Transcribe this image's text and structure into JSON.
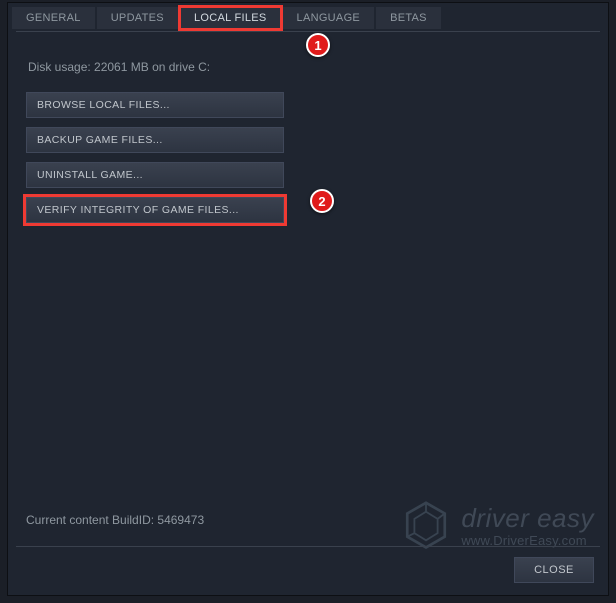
{
  "tabs": {
    "general": "GENERAL",
    "updates": "UPDATES",
    "local_files": "LOCAL FILES",
    "language": "LANGUAGE",
    "betas": "BETAS"
  },
  "disk_usage": "Disk usage: 22061 MB on drive C:",
  "buttons": {
    "browse": "BROWSE LOCAL FILES...",
    "backup": "BACKUP GAME FILES...",
    "uninstall": "UNINSTALL GAME...",
    "verify": "VERIFY INTEGRITY OF GAME FILES..."
  },
  "callouts": {
    "one": "1",
    "two": "2"
  },
  "build_id": "Current content BuildID: 5469473",
  "close": "CLOSE",
  "watermark": {
    "title": "driver easy",
    "url": "www.DriverEasy.com"
  }
}
